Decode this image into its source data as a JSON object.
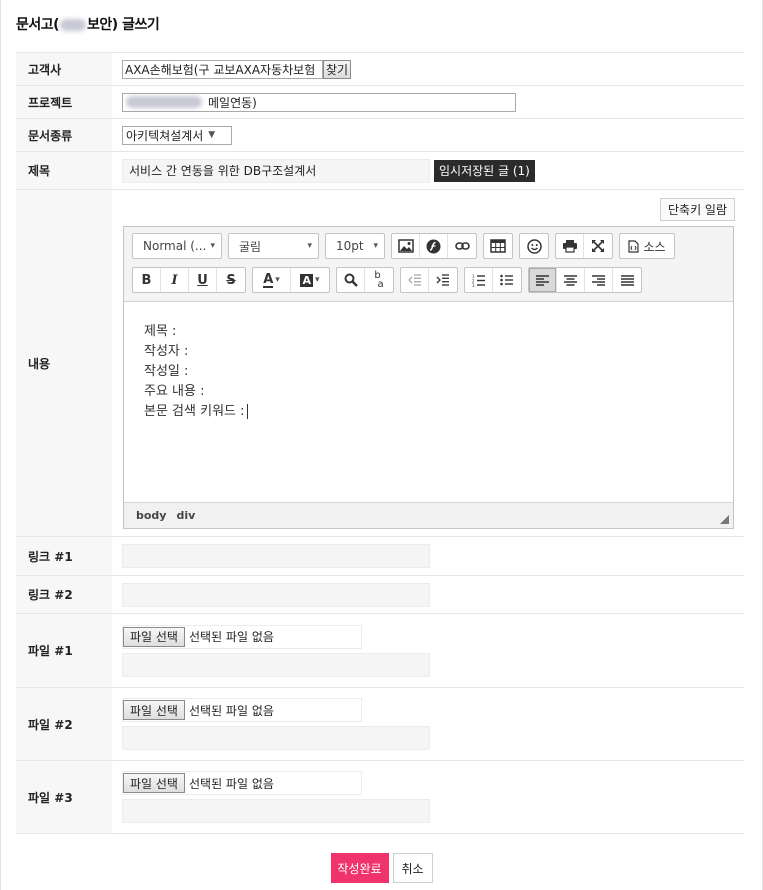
{
  "page": {
    "title_prefix": "문서고(",
    "title_suffix": "보안) 글쓰기"
  },
  "form": {
    "customer": {
      "label": "고객사",
      "value": "AXA손해보험(구 교보AXA자동차보험",
      "find_button": "찾기"
    },
    "project": {
      "label": "프로젝트",
      "value_visible": "메일연동)"
    },
    "doc_type": {
      "label": "문서종류",
      "selected": "아키텍쳐설계서"
    },
    "subject": {
      "label": "제목",
      "value": "서비스 간 연동을 위한 DB구조설계서",
      "temp_saved_button": "임시저장된 글 (1)"
    },
    "content": {
      "label": "내용",
      "shortcut_button": "단축키 일람",
      "lines": [
        "제목 :",
        "작성자 :",
        "작성일 :",
        "주요 내용 :",
        "본문 검색 키워드 :"
      ],
      "status_path": [
        "body",
        "div"
      ]
    },
    "link1": {
      "label": "링크 #1",
      "value": ""
    },
    "link2": {
      "label": "링크 #2",
      "value": ""
    },
    "file1": {
      "label": "파일 #1",
      "button": "파일 선택",
      "status": "선택된 파일 없음"
    },
    "file2": {
      "label": "파일 #2",
      "button": "파일 선택",
      "status": "선택된 파일 없음"
    },
    "file3": {
      "label": "파일 #3",
      "button": "파일 선택",
      "status": "선택된 파일 없음"
    }
  },
  "editor_toolbar": {
    "format_combo": "Normal (...",
    "font_combo": "굴림",
    "size_combo": "10pt",
    "source_button": "소스",
    "icons_row1": [
      "image-icon",
      "flash-icon",
      "link-icon",
      "table-icon",
      "smiley-icon",
      "print-icon",
      "maximize-icon",
      "source-icon"
    ],
    "icons_row2": [
      "bold-icon",
      "italic-icon",
      "underline-icon",
      "strike-icon",
      "text-color-icon",
      "bg-color-icon",
      "find-icon",
      "replace-icon",
      "outdent-icon",
      "indent-icon",
      "numbered-list-icon",
      "bulleted-list-icon",
      "align-left-icon",
      "align-center-icon",
      "align-right-icon",
      "justify-icon"
    ],
    "active_align": "left"
  },
  "actions": {
    "submit": "작성완료",
    "cancel": "취소"
  },
  "colors": {
    "submit": "#f0336a",
    "temp_saved": "#2b2b2b",
    "label_bg": "#f7f7f7"
  }
}
